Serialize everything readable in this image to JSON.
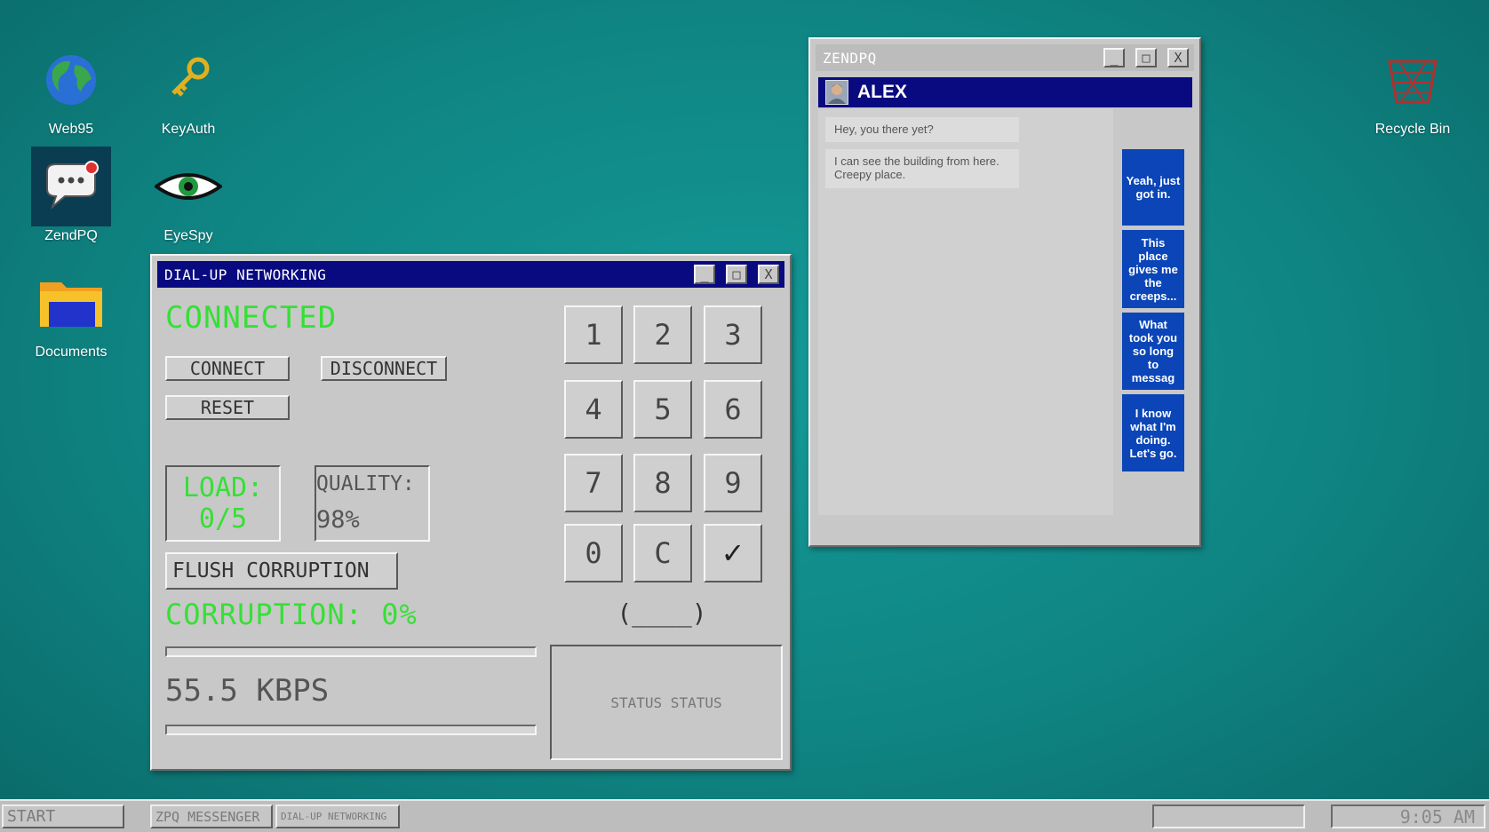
{
  "desktop": {
    "icons": [
      {
        "label": "Web95",
        "icon": "globe-icon"
      },
      {
        "label": "KeyAuth",
        "icon": "key-icon"
      },
      {
        "label": "ZendPQ",
        "icon": "chat-bubble-icon"
      },
      {
        "label": "EyeSpy",
        "icon": "eye-icon"
      },
      {
        "label": "Documents",
        "icon": "folder-icon"
      },
      {
        "label": "Recycle Bin",
        "icon": "recycle-bin-icon"
      }
    ]
  },
  "dialup": {
    "title": "DIAL-UP NETWORKING",
    "status": "CONNECTED",
    "connect_label": "CONNECT",
    "disconnect_label": "DISCONNECT",
    "reset_label": "RESET",
    "load_label": "LOAD:",
    "load_value": "0/5",
    "quality_label": "QUALITY:",
    "quality_value": "98%",
    "flush_label": "FLUSH CORRUPTION",
    "corruption_text": "CORRUPTION: 0%",
    "speed_text": "55.5 KBPS",
    "status_box_text": "STATUS STATUS",
    "keypad": [
      "1",
      "2",
      "3",
      "4",
      "5",
      "6",
      "7",
      "8",
      "9",
      "0",
      "C",
      "✓"
    ],
    "dial_display": "(____)",
    "window_buttons": {
      "minimize": "_",
      "maximize": "□",
      "close": "X"
    }
  },
  "chat": {
    "title": "ZENDPQ",
    "contact_name": "ALEX",
    "incoming": [
      "Hey, you there yet?",
      "I can see the building from here. Creepy place."
    ],
    "replies": [
      "Yeah, just got in.",
      "This place gives me the creeps...",
      "What took you so long to messag",
      "I know what I'm doing. Let's go."
    ],
    "window_buttons": {
      "minimize": "_",
      "maximize": "□",
      "close": "X"
    }
  },
  "taskbar": {
    "start_label": "START",
    "tasks": [
      "ZPQ MESSENGER",
      "DIAL-UP NETWORKING"
    ],
    "clock": "9:05 AM"
  },
  "colors": {
    "desktop": "#0f8583",
    "titlebar": "#0a0a80",
    "terminal_green": "#35e035",
    "reply_blue": "#0b45b8"
  }
}
